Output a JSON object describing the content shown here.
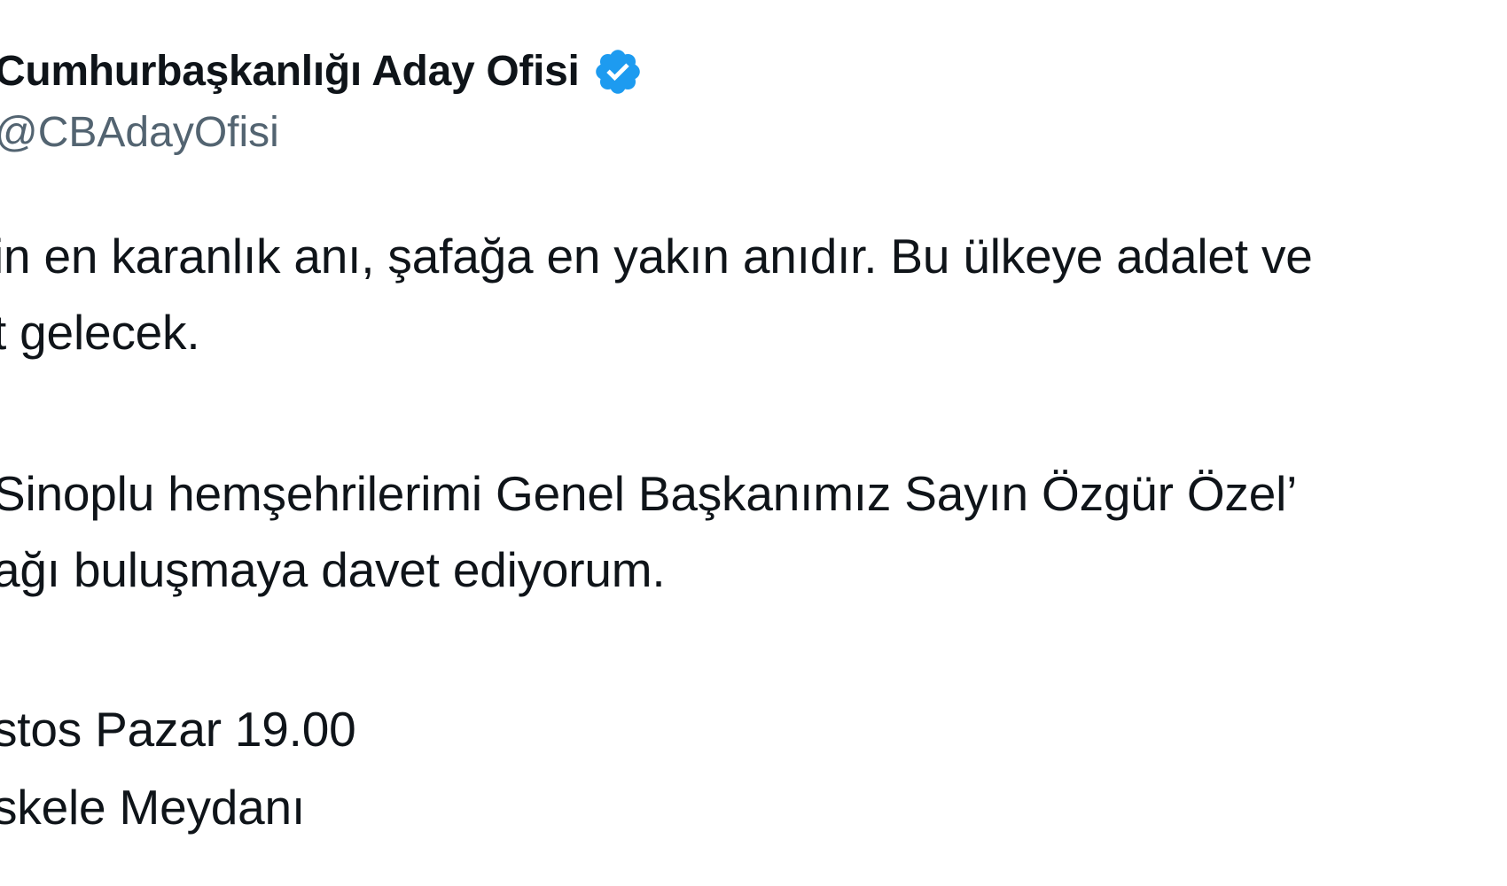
{
  "author": {
    "display_name": "Cumhurbaşkanlığı Aday Ofisi",
    "handle": "@CBAdayOfisi",
    "verified_icon": "verified-badge-icon",
    "verified_color": "#1d9bf0"
  },
  "tweet": {
    "lines": [
      "in en karanlık anı, şafağa en yakın anıdır. Bu ülkeye adalet ve",
      "t gelecek.",
      "Sinoplu hemşehrilerimi Genel Başkanımız Sayın Özgür Özel’",
      "ağı buluşmaya davet ediyorum.",
      "stos Pazar 19.00",
      "skele Meydanı"
    ]
  }
}
